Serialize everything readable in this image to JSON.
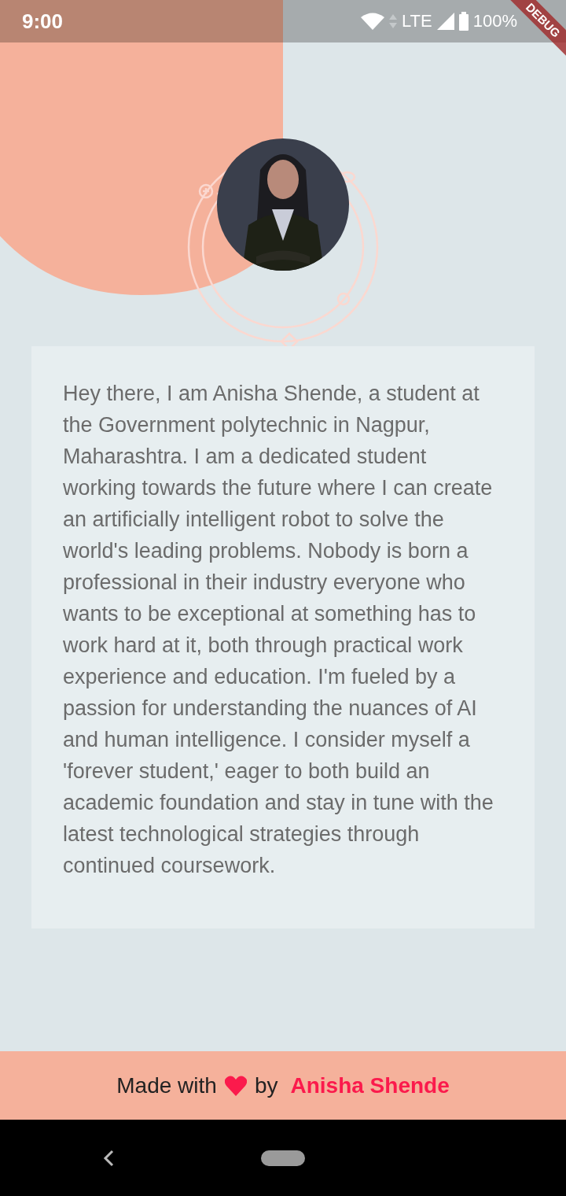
{
  "status_bar": {
    "time": "9:00",
    "network": "LTE",
    "battery": "100%"
  },
  "debug_banner": "DEBUG",
  "about": {
    "text": "Hey there, I am Anisha Shende, a student at the Government polytechnic in Nagpur, Maharashtra. I am a dedicated student working towards the future where I can create an artificially intelligent robot to solve the world's leading problems. Nobody is born a professional in their industry everyone who wants to be exceptional at something has to work hard at it, both through practical work experience and education. I'm fueled by a passion for understanding the nuances of AI and human intelligence. I consider myself a 'forever student,' eager to both build an academic foundation and stay in tune with the latest technological strategies through continued coursework."
  },
  "footer": {
    "made_with": "Made with",
    "by": "by",
    "author": "Anisha Shende"
  }
}
